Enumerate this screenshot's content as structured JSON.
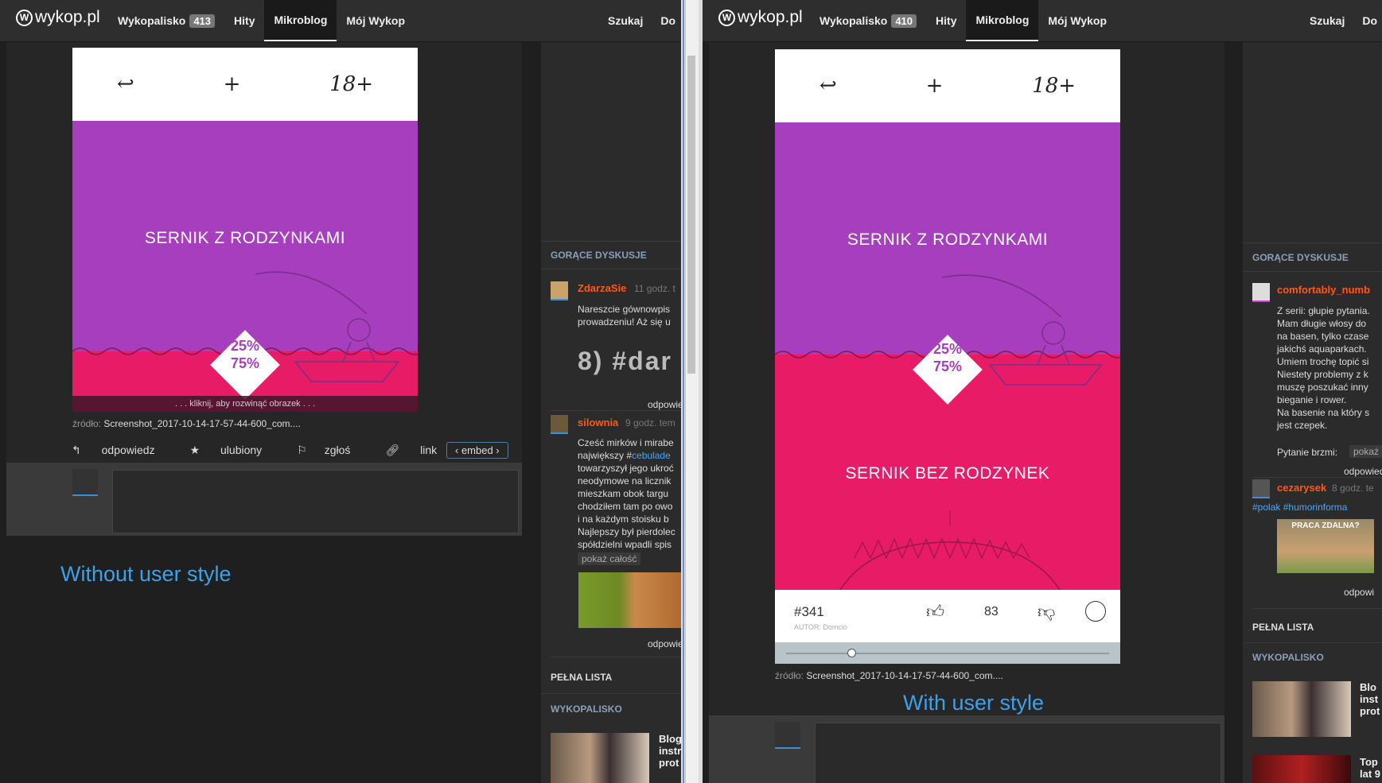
{
  "brand": "wykop.pl",
  "left": {
    "nav": {
      "wykopalisko": "Wykopalisko",
      "wykopalisko_count": "413",
      "hity": "Hity",
      "mikroblog": "Mikroblog",
      "moj": "Mój Wykop",
      "szukaj": "Szukaj",
      "cut": "Do"
    },
    "image": {
      "title": "SERNIK Z RODZYNKAMI",
      "pct_top": "25%",
      "pct_bottom": "75%",
      "expand": ". . . kliknij, aby rozwinąć obrazek . . .",
      "icons": [
        "↩",
        "+",
        "18+"
      ]
    },
    "source_label": "źródło:",
    "source_name": "Screenshot_2017-10-14-17-57-44-600_com....",
    "actions": {
      "reply": "odpowiedz",
      "fav": "ulubiony",
      "report": "zgłoś",
      "link": "link",
      "embed": "‹ embed ›"
    },
    "caption": "Without user style",
    "sidebar": {
      "hot_head": "GORĄCE DYSKUSJE",
      "p1": {
        "user": "ZdarzaSie",
        "time": "11 godz. t",
        "text": "Nareszcie gównowpis\nprowadzeniu! Aż się u",
        "gif": "8)  #dar",
        "reply": "odpowiedz"
      },
      "p2": {
        "user": "silownia",
        "time": "9 godz. tem",
        "text_a": "Cześć mirków i mirabe",
        "text_b": "największy #",
        "tag": "cebulade",
        "text_c": "towarzyszył jego ukroć\nneodymowe na licznik\nmieszkam obok targu\nchodziłem tam po owo\ni na każdym stoisku b\nNajlepszy był pierdolec\nspółdzielni wpadli spis",
        "more": "pokaż całość",
        "reply": "odpowiedz"
      },
      "full_list": "PEŁNA LISTA",
      "wyk_head": "WYKOPALISKO",
      "news": "Blog\ninstr\nprot"
    }
  },
  "right": {
    "nav": {
      "wykopalisko": "Wykopalisko",
      "wykopalisko_count": "410",
      "hity": "Hity",
      "mikroblog": "Mikroblog",
      "moj": "Mój Wykop",
      "szukaj": "Szukaj",
      "cut": "Do"
    },
    "image": {
      "title": "SERNIK Z RODZYNKAMI",
      "title2": "SERNIK BEZ RODZYNEK",
      "pct_top": "25%",
      "pct_bottom": "75%",
      "icons": [
        "↩",
        "+",
        "18+"
      ],
      "number": "#341",
      "author": "AUTOR: Domcio",
      "likes": "83"
    },
    "source_label": "źródło:",
    "source_name": "Screenshot_2017-10-14-17-57-44-600_com....",
    "caption": "With user style",
    "sidebar": {
      "hot_head": "GORĄCE DYSKUSJE",
      "p1": {
        "user": "comfortably_numb",
        "text": "Z serii: głupie pytania.\nMam długie włosy do\nna basen, tylko czase\njakichś aquaparkach.\nUmiem trochę topić si\nNiestety problemy z k\nmuszę poszukać inny\nbieganie i rower.\nNa basenie na który s\njest czepek.",
        "question": "Pytanie brzmi:",
        "more": "pokaż",
        "reply": "odpowiedz"
      },
      "p2": {
        "user": "cezarysek",
        "time": "8 godz. te",
        "tag1": "#polak",
        "tag2": "#humorinforma",
        "meme": "PRACA ZDALNA?",
        "reply": "odpowi"
      },
      "full_list": "PEŁNA LISTA",
      "wyk_head": "WYKOPALISKO",
      "news1": "Blo\ninst\nprot",
      "news2": "Top\nlat 9"
    }
  },
  "colors": {
    "purple": "#a73ebd",
    "pink": "#e81b66",
    "accent": "#3fa0ea",
    "username": "#ff5917"
  }
}
